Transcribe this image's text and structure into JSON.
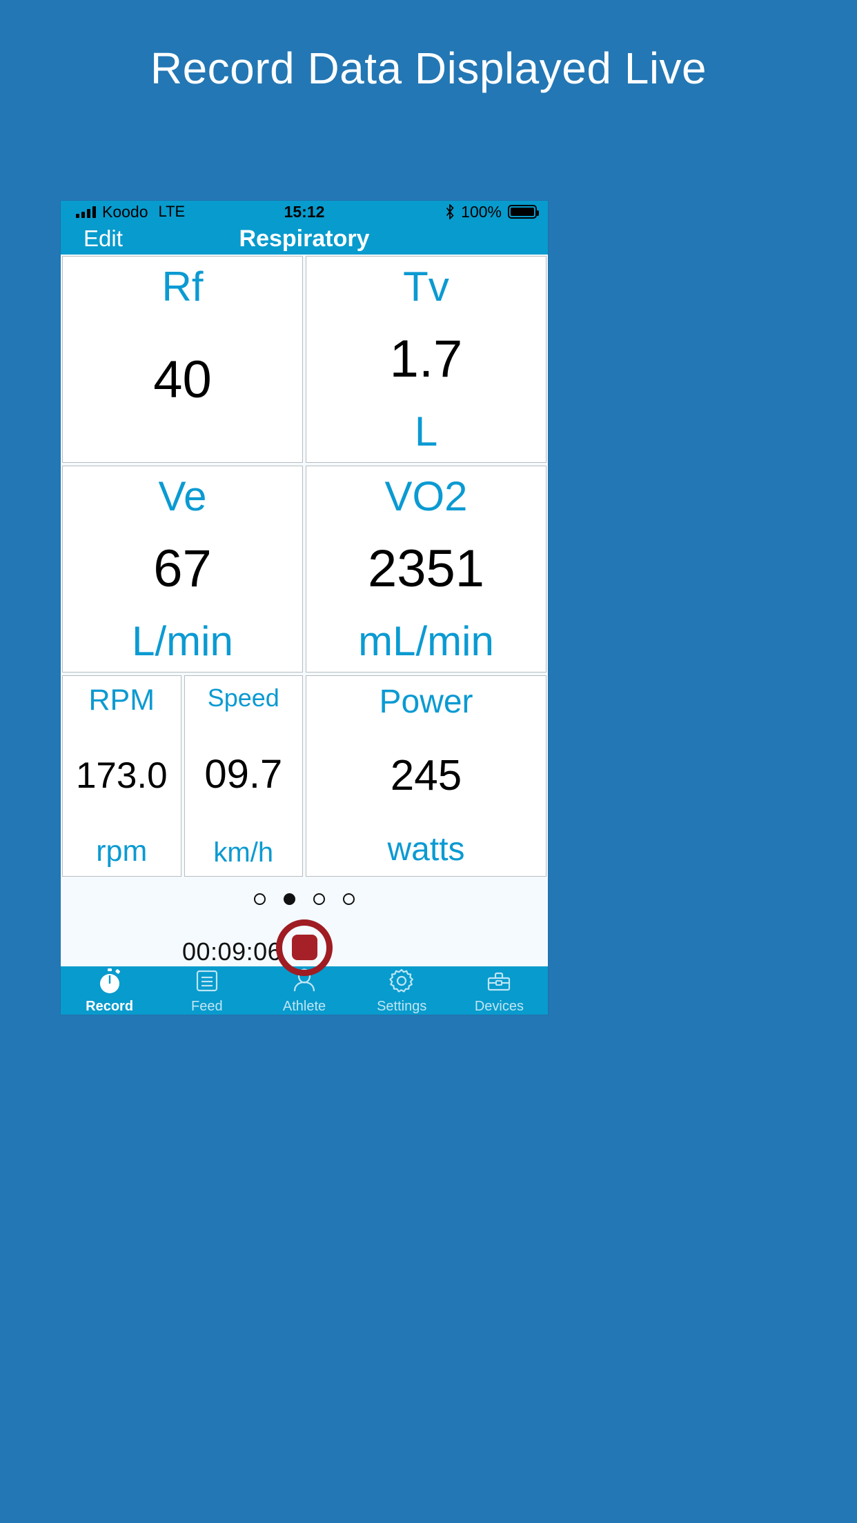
{
  "slide": {
    "title": "Record Data Displayed Live"
  },
  "status_bar": {
    "signal_icon": "signal-bars-icon",
    "carrier": "Koodo",
    "network": "LTE",
    "time": "15:12",
    "bluetooth_icon": "bluetooth-icon",
    "battery_percent": "100%",
    "battery_icon": "battery-full-icon"
  },
  "nav_bar": {
    "edit_label": "Edit",
    "title": "Respiratory"
  },
  "metrics": [
    [
      {
        "label": "Rf",
        "value": "40",
        "unit": ""
      },
      {
        "label": "Tv",
        "value": "1.7",
        "unit": "L"
      }
    ],
    [
      {
        "label": "Ve",
        "value": "67",
        "unit": "L/min"
      },
      {
        "label": "VO2",
        "value": "2351",
        "unit": "mL/min"
      }
    ],
    [
      {
        "label": "RPM",
        "value": "173.0",
        "unit": "rpm"
      },
      {
        "label": "Speed",
        "value": "09.7",
        "unit": "km/h"
      },
      {
        "label": "Power",
        "value": "245",
        "unit": "watts"
      }
    ]
  ],
  "pager": {
    "count": 4,
    "active_index": 1
  },
  "controls": {
    "elapsed_time": "00:09:06",
    "record_button_icon": "stop-record-icon",
    "record_button_color": "#a52127"
  },
  "tabs": [
    {
      "label": "Record",
      "icon": "stopwatch-icon",
      "active": true
    },
    {
      "label": "Feed",
      "icon": "list-icon",
      "active": false
    },
    {
      "label": "Athlete",
      "icon": "person-icon",
      "active": false
    },
    {
      "label": "Settings",
      "icon": "gear-icon",
      "active": false
    },
    {
      "label": "Devices",
      "icon": "toolbox-icon",
      "active": false
    }
  ],
  "colors": {
    "slide_background": "#2377b4",
    "app_accent": "#089bcd",
    "metric_label": "#0b9ad2",
    "metric_value": "#000000"
  }
}
